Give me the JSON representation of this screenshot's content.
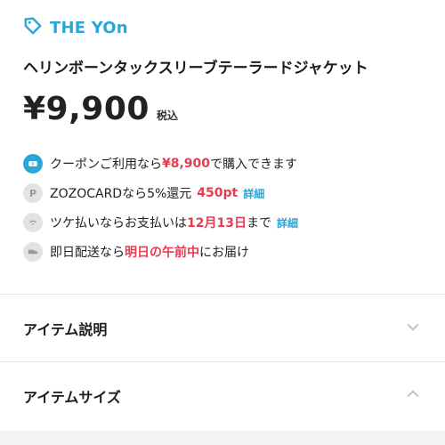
{
  "brand": {
    "name": "THE YOn"
  },
  "product": {
    "title": "ヘリンボーンタックスリーブテーラードジャケット",
    "price": "¥9,900",
    "tax_label": "税込"
  },
  "info": {
    "coupon": {
      "prefix": "クーポンご利用なら",
      "price": "¥8,900",
      "suffix": "で購入できます"
    },
    "zozocard": {
      "text": "ZOZOCARDなら5%還元",
      "points": "450pt",
      "link": "詳細"
    },
    "tsuke": {
      "prefix": "ツケ払いならお支払いは",
      "date": "12月13日",
      "suffix": "まで",
      "link": "詳細"
    },
    "delivery": {
      "prefix": "即日配送なら",
      "highlight": "明日の午前中",
      "suffix": "にお届け"
    }
  },
  "accordion": {
    "description_label": "アイテム説明",
    "size_label": "アイテムサイズ"
  },
  "colors": {
    "accent": "#2aa7d8",
    "highlight": "#e83b52"
  }
}
